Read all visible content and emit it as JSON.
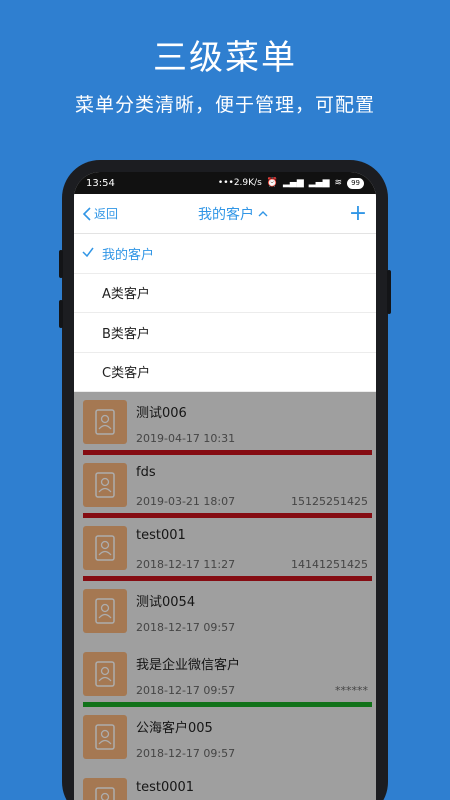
{
  "promo": {
    "title": "三级菜单",
    "subtitle": "菜单分类清晰，便于管理，可配置"
  },
  "status": {
    "time": "13:54",
    "speed": "•••2.9K/s",
    "battery": "99"
  },
  "nav": {
    "back_label": "返回",
    "title": "我的客户"
  },
  "dropdown": {
    "items": [
      {
        "label": "我的客户",
        "selected": true
      },
      {
        "label": "A类客户",
        "selected": false
      },
      {
        "label": "B类客户",
        "selected": false
      },
      {
        "label": "C类客户",
        "selected": false
      }
    ]
  },
  "customers": [
    {
      "name": "测试006",
      "date": "2019-04-17 10:31",
      "phone": "",
      "bar_color": "#c4121b"
    },
    {
      "name": "fds",
      "date": "2019-03-21 18:07",
      "phone": "15125251425",
      "bar_color": "#c4121b"
    },
    {
      "name": "test001",
      "date": "2018-12-17 11:27",
      "phone": "14141251425",
      "bar_color": "#c4121b"
    },
    {
      "name": "测试0054",
      "date": "2018-12-17 09:57",
      "phone": "",
      "bar_color": ""
    },
    {
      "name": "我是企业微信客户",
      "date": "2018-12-17 09:57",
      "phone": "******",
      "bar_color": "#1aa826"
    },
    {
      "name": "公海客户005",
      "date": "2018-12-17 09:57",
      "phone": "",
      "bar_color": ""
    },
    {
      "name": "test0001",
      "date": "",
      "phone": "",
      "bar_color": ""
    }
  ],
  "colors": {
    "background": "#2f7fd0",
    "accent": "#3196e6",
    "avatar": "#f4b27a"
  }
}
